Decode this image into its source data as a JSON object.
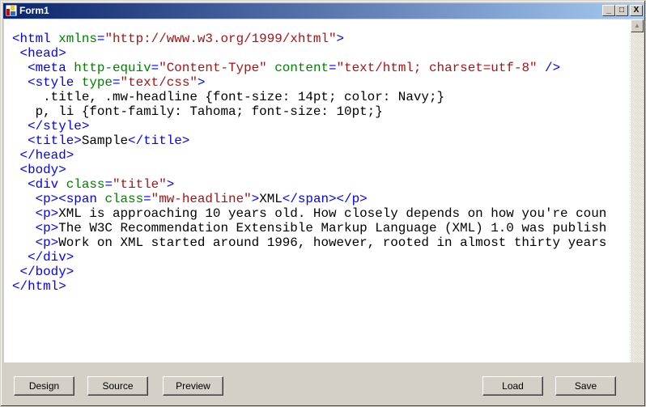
{
  "window": {
    "title": "Form1",
    "minimize": "_",
    "maximize": "□",
    "close": "X"
  },
  "editor": {
    "lines": [
      [
        {
          "c": "t",
          "s": "<html "
        },
        {
          "c": "a",
          "s": "xmlns"
        },
        {
          "c": "t",
          "s": "="
        },
        {
          "c": "v",
          "s": "\"http://www.w3.org/1999/xhtml\""
        },
        {
          "c": "t",
          "s": ">"
        }
      ],
      [
        {
          "c": "t",
          "s": " <head>"
        }
      ],
      [
        {
          "c": "t",
          "s": "  <meta "
        },
        {
          "c": "a",
          "s": "http-equiv"
        },
        {
          "c": "t",
          "s": "="
        },
        {
          "c": "v",
          "s": "\"Content-Type\""
        },
        {
          "c": "",
          "s": " "
        },
        {
          "c": "a",
          "s": "content"
        },
        {
          "c": "t",
          "s": "="
        },
        {
          "c": "v",
          "s": "\"text/html; charset=utf-8\""
        },
        {
          "c": "t",
          "s": " />"
        }
      ],
      [
        {
          "c": "t",
          "s": "  <style "
        },
        {
          "c": "a",
          "s": "type"
        },
        {
          "c": "t",
          "s": "="
        },
        {
          "c": "v",
          "s": "\"text/css\""
        },
        {
          "c": "t",
          "s": ">"
        }
      ],
      [
        {
          "c": "",
          "s": "    .title, .mw-headline {font-size: 14pt; color: Navy;}"
        }
      ],
      [
        {
          "c": "",
          "s": "   p, li {font-family: Tahoma; font-size: 10pt;}"
        }
      ],
      [
        {
          "c": "t",
          "s": "  </style>"
        }
      ],
      [
        {
          "c": "t",
          "s": "  <title>"
        },
        {
          "c": "",
          "s": "Sample"
        },
        {
          "c": "t",
          "s": "</title>"
        }
      ],
      [
        {
          "c": "t",
          "s": " </head>"
        }
      ],
      [
        {
          "c": "t",
          "s": " <body>"
        }
      ],
      [
        {
          "c": "t",
          "s": "  <div "
        },
        {
          "c": "a",
          "s": "class"
        },
        {
          "c": "t",
          "s": "="
        },
        {
          "c": "v",
          "s": "\"title\""
        },
        {
          "c": "t",
          "s": ">"
        }
      ],
      [
        {
          "c": "t",
          "s": "   <p><span "
        },
        {
          "c": "a",
          "s": "class"
        },
        {
          "c": "t",
          "s": "="
        },
        {
          "c": "v",
          "s": "\"mw-headline\""
        },
        {
          "c": "t",
          "s": ">"
        },
        {
          "c": "",
          "s": "XML"
        },
        {
          "c": "t",
          "s": "</span></p>"
        }
      ],
      [
        {
          "c": "t",
          "s": "   <p>"
        },
        {
          "c": "",
          "s": "XML is approaching 10 years old. How closely depends on how you're coun"
        }
      ],
      [
        {
          "c": "t",
          "s": "   <p>"
        },
        {
          "c": "",
          "s": "The W3C Recommendation Extensible Markup Language (XML) 1.0 was publish"
        }
      ],
      [
        {
          "c": "t",
          "s": "   <p>"
        },
        {
          "c": "",
          "s": "Work on XML started around 1996, however, rooted in almost thirty years"
        }
      ],
      [
        {
          "c": "t",
          "s": "  </div>"
        }
      ],
      [
        {
          "c": "t",
          "s": " </body>"
        }
      ],
      [
        {
          "c": "t",
          "s": "</html>"
        }
      ]
    ]
  },
  "buttons": {
    "design": "Design",
    "source": "Source",
    "preview": "Preview",
    "load": "Load",
    "save": "Save"
  },
  "scroll_up": "▲"
}
